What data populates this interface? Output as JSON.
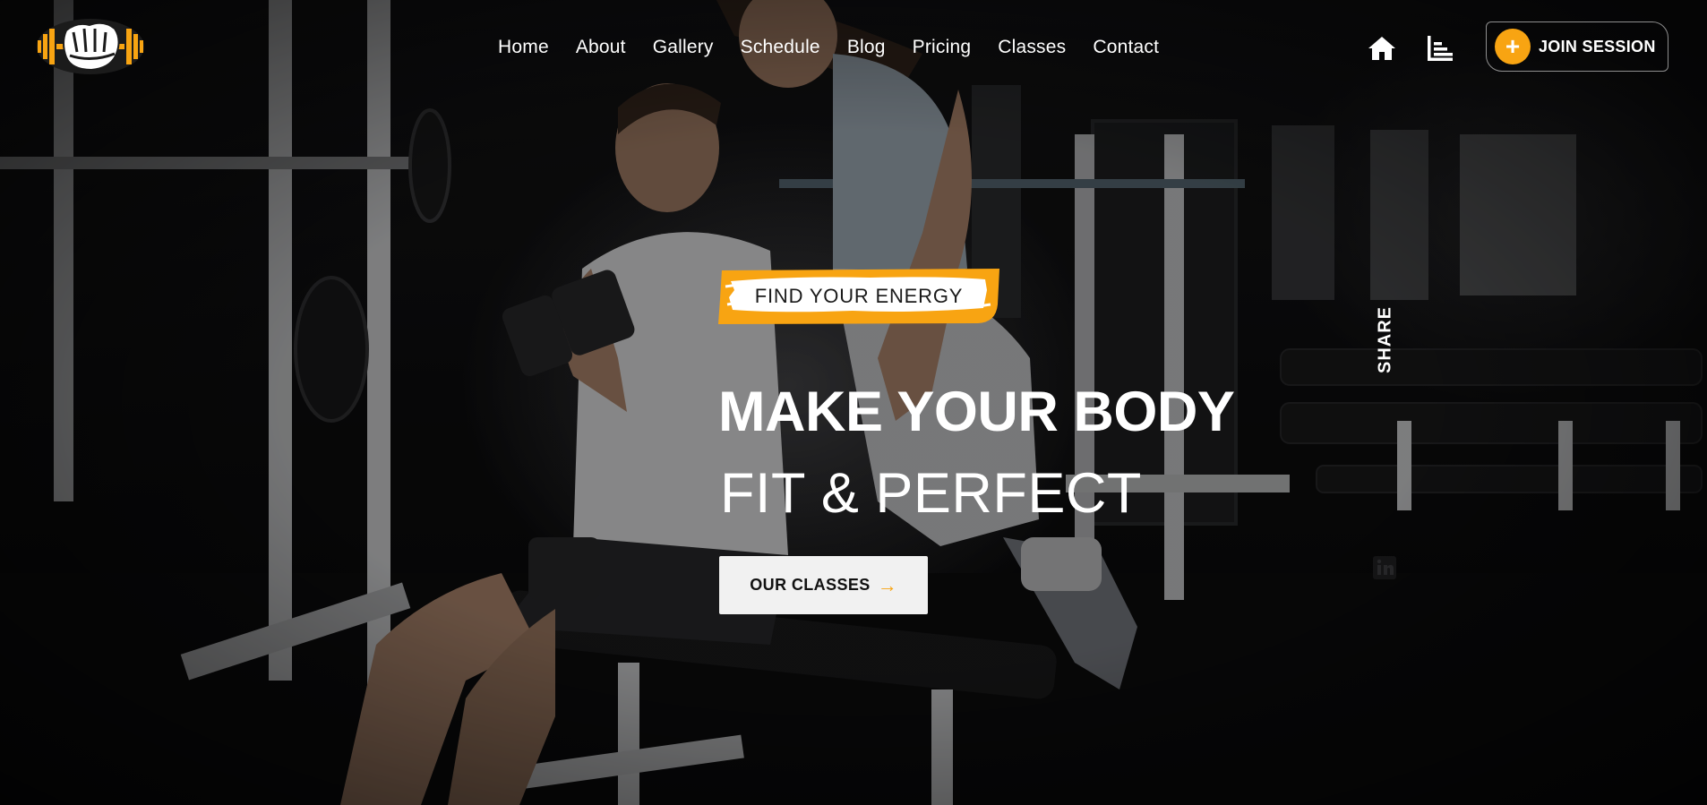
{
  "brand": {
    "logo_icon": "fist-dumbbell-logo-icon",
    "accent_color": "#f8a412"
  },
  "nav": {
    "items": [
      {
        "label": "Home"
      },
      {
        "label": "About"
      },
      {
        "label": "Gallery"
      },
      {
        "label": "Schedule"
      },
      {
        "label": "Blog"
      },
      {
        "label": "Pricing"
      },
      {
        "label": "Classes"
      },
      {
        "label": "Contact"
      }
    ]
  },
  "header_actions": {
    "home_icon": "home-icon",
    "menu_icon": "bar-chart-menu-icon",
    "join_label": "JOIN SESSION",
    "join_icon": "plus-icon"
  },
  "hero": {
    "tagline": "FIND YOUR ENERGY",
    "headline_line1": "MAKE YOUR BODY",
    "headline_line2": "FIT & PERFECT",
    "cta_label": "OUR CLASSES",
    "cta_icon": "arrow-right-icon"
  },
  "share": {
    "label": "SHARE",
    "social_icon": "linkedin-icon"
  }
}
